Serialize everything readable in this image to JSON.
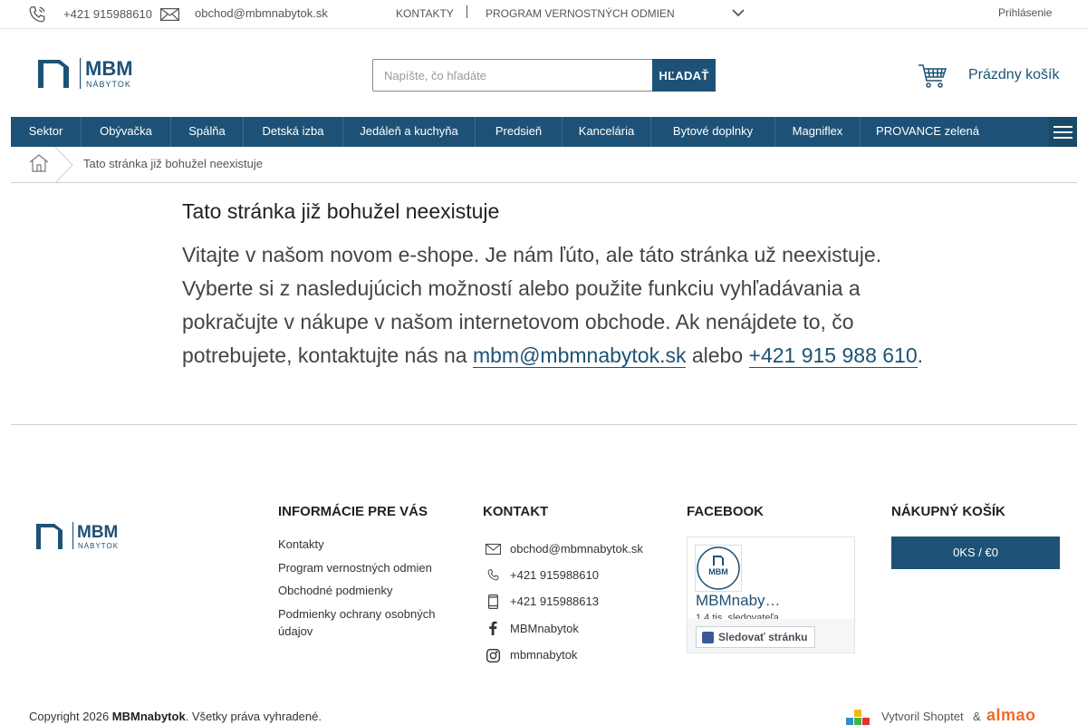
{
  "topbar": {
    "phone": "+421 915988610",
    "email": "obchod@mbmnabytok.sk",
    "contacts_link": "KONTAKTY",
    "loyalty_link": "PROGRAM VERNOSTNÝCH ODMIEN",
    "login": "Prihlásenie"
  },
  "logo": {
    "main": "MBM",
    "sub": "NÁBYTOK"
  },
  "search": {
    "placeholder": "Napíšte, čo hľadáte",
    "button": "HĽADAŤ"
  },
  "cart": {
    "label": "Prázdny košík"
  },
  "nav": {
    "items": [
      {
        "label": "Sektor"
      },
      {
        "label": "Obývačka"
      },
      {
        "label": "Spálňa"
      },
      {
        "label": "Detská izba"
      },
      {
        "label": "Jedáleň a kuchyňa"
      },
      {
        "label": "Predsieň"
      },
      {
        "label": "Kancelária"
      },
      {
        "label": "Bytové doplnky"
      },
      {
        "label": "Magniflex"
      },
      {
        "label": "PROVANCE zelená"
      }
    ]
  },
  "breadcrumb": {
    "current": "Tato stránka již bohužel neexistuje"
  },
  "main": {
    "title": "Tato stránka již bohužel neexistuje",
    "text": "Vitajte v našom novom e-shope. Je nám ľúto, ale táto stránka už neexistuje. Vyberte si z nasledujúcich možností alebo použite funkciu vyhľadávania a pokračujte v nákupe v našom internetovom obchode. Ak nenájdete to, čo potrebujete, kontaktujte nás na",
    "email_link": "mbm@mbmnabytok.sk",
    "or": "alebo",
    "phone_link": "+421 915 988 610",
    "end": "."
  },
  "footer": {
    "info": {
      "heading": "INFORMÁCIE PRE VÁS",
      "links": [
        "Kontakty",
        "Program vernostných odmien",
        "Obchodné podmienky",
        "Podmienky ochrany osobných údajov"
      ]
    },
    "contact": {
      "heading": "KONTAKT",
      "email": "obchod@mbmnabytok.sk",
      "phone1": "+421 915988610",
      "phone2": "+421 915988613",
      "facebook": "MBMnabytok",
      "instagram": "mbmnabytok"
    },
    "facebook": {
      "heading": "FACEBOOK",
      "page_name": "MBMnaby…",
      "followers": "1,4 tis. sledovateľa",
      "follow_button": "Sledovať stránku",
      "avatar_text": "MBM"
    },
    "cart": {
      "heading": "NÁKUPNÝ KOŠÍK",
      "button": "0KS / €0"
    },
    "copyright_prefix": "Copyright 2026",
    "copyright_brand": "MBMnabytok",
    "copyright_suffix": ". Všetky práva vyhradené.",
    "made_by": "Vytvoril Shoptet",
    "amp": "&",
    "agency": "almao"
  },
  "colors": {
    "brand": "#1d5276",
    "nav_border": "#3a6a8e",
    "agency": "#f06a2a"
  }
}
